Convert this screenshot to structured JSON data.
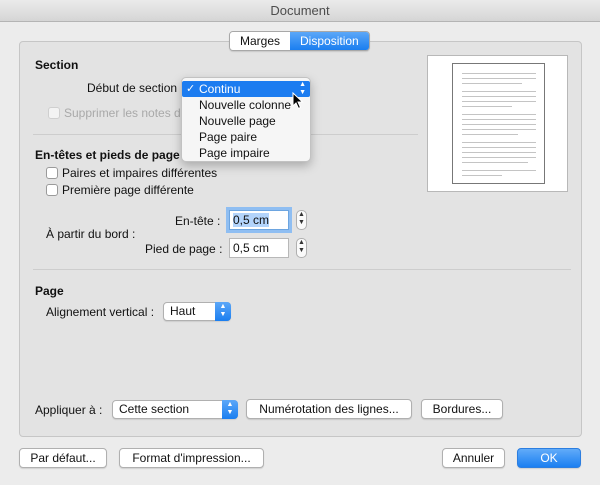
{
  "window": {
    "title": "Document"
  },
  "tabs": [
    {
      "label": "Marges",
      "active": false
    },
    {
      "label": "Disposition",
      "active": true
    }
  ],
  "section": {
    "title": "Section",
    "start_label": "Début de section",
    "start_menu": {
      "options": [
        "Continu",
        "Nouvelle colonne",
        "Nouvelle page",
        "Page paire",
        "Page impaire"
      ],
      "selected": "Continu"
    },
    "suppress_notes_label": "Supprimer les notes de"
  },
  "headers_footers": {
    "title": "En-têtes et pieds de page",
    "odd_even_label": "Paires et impaires différentes",
    "first_page_label": "Première page différente",
    "from_edge_label": "À partir du bord :",
    "header_label": "En-tête :",
    "header_value": "0,5 cm",
    "footer_label": "Pied de page :",
    "footer_value": "0,5 cm"
  },
  "page": {
    "title": "Page",
    "vertical_align_label": "Alignement vertical :",
    "vertical_align_value": "Haut"
  },
  "apply": {
    "label": "Appliquer à :",
    "value": "Cette section",
    "line_numbers_button": "Numérotation des lignes...",
    "borders_button": "Bordures..."
  },
  "footer_buttons": {
    "default": "Par défaut...",
    "page_setup": "Format d'impression...",
    "cancel": "Annuler",
    "ok": "OK"
  },
  "colors": {
    "accent": "#1c7cf0"
  },
  "icons": {
    "checkmark": "checkmark-icon",
    "stepper": "stepper-arrows-icon",
    "popup": "popup-arrows-icon",
    "cursor": "mouse-pointer-icon"
  }
}
